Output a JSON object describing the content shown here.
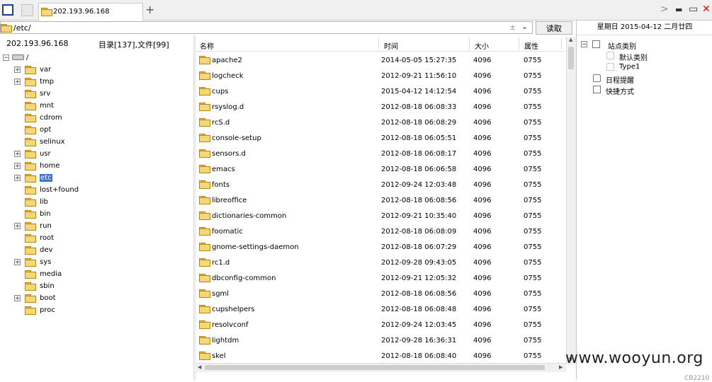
{
  "tab": {
    "title": "202.193.96.168",
    "add_label": "+"
  },
  "window": {
    "forward": ">",
    "minimize": "▬",
    "restore": "▭",
    "close": "✕"
  },
  "pathbar": {
    "path": "/etc/",
    "dropdown_plus": "±",
    "read_label": "读取"
  },
  "left_header": {
    "host": "202.193.96.168",
    "counts": "目录[137],文件[99]"
  },
  "tree": {
    "root": "/",
    "items": [
      {
        "label": "var",
        "expandable": true
      },
      {
        "label": "tmp",
        "expandable": true
      },
      {
        "label": "srv",
        "expandable": false
      },
      {
        "label": "mnt",
        "expandable": false
      },
      {
        "label": "cdrom",
        "expandable": false
      },
      {
        "label": "opt",
        "expandable": false
      },
      {
        "label": "selinux",
        "expandable": false
      },
      {
        "label": "usr",
        "expandable": true
      },
      {
        "label": "home",
        "expandable": true
      },
      {
        "label": "etc",
        "expandable": true,
        "selected": true
      },
      {
        "label": "lost+found",
        "expandable": false
      },
      {
        "label": "lib",
        "expandable": false
      },
      {
        "label": "bin",
        "expandable": false
      },
      {
        "label": "run",
        "expandable": true
      },
      {
        "label": "root",
        "expandable": false
      },
      {
        "label": "dev",
        "expandable": false
      },
      {
        "label": "sys",
        "expandable": true
      },
      {
        "label": "media",
        "expandable": false
      },
      {
        "label": "sbin",
        "expandable": false
      },
      {
        "label": "boot",
        "expandable": true
      },
      {
        "label": "proc",
        "expandable": false
      }
    ]
  },
  "list": {
    "columns": {
      "name": "名称",
      "time": "时间",
      "size": "大小",
      "attr": "属性"
    },
    "rows": [
      {
        "name": "apache2",
        "time": "2014-05-05 15:27:35",
        "size": "4096",
        "attr": "0755"
      },
      {
        "name": "logcheck",
        "time": "2012-09-21 11:56:10",
        "size": "4096",
        "attr": "0755"
      },
      {
        "name": "cups",
        "time": "2015-04-12 14:12:54",
        "size": "4096",
        "attr": "0755"
      },
      {
        "name": "rsyslog.d",
        "time": "2012-08-18 06:08:33",
        "size": "4096",
        "attr": "0755"
      },
      {
        "name": "rcS.d",
        "time": "2012-08-18 06:08:29",
        "size": "4096",
        "attr": "0755"
      },
      {
        "name": "console-setup",
        "time": "2012-08-18 06:05:51",
        "size": "4096",
        "attr": "0755"
      },
      {
        "name": "sensors.d",
        "time": "2012-08-18 06:08:17",
        "size": "4096",
        "attr": "0755"
      },
      {
        "name": "emacs",
        "time": "2012-08-18 06:06:58",
        "size": "4096",
        "attr": "0755"
      },
      {
        "name": "fonts",
        "time": "2012-09-24 12:03:48",
        "size": "4096",
        "attr": "0755"
      },
      {
        "name": "libreoffice",
        "time": "2012-08-18 06:08:56",
        "size": "4096",
        "attr": "0755"
      },
      {
        "name": "dictionaries-common",
        "time": "2012-09-21 10:35:40",
        "size": "4096",
        "attr": "0755"
      },
      {
        "name": "foomatic",
        "time": "2012-08-18 06:08:09",
        "size": "4096",
        "attr": "0755"
      },
      {
        "name": "gnome-settings-daemon",
        "time": "2012-08-18 06:07:29",
        "size": "4096",
        "attr": "0755"
      },
      {
        "name": "rc1.d",
        "time": "2012-09-28 09:43:05",
        "size": "4096",
        "attr": "0755"
      },
      {
        "name": "dbconfig-common",
        "time": "2012-09-21 12:05:32",
        "size": "4096",
        "attr": "0755"
      },
      {
        "name": "sgml",
        "time": "2012-08-18 06:08:56",
        "size": "4096",
        "attr": "0755"
      },
      {
        "name": "cupshelpers",
        "time": "2012-08-18 06:08:48",
        "size": "4096",
        "attr": "0755"
      },
      {
        "name": "resolvconf",
        "time": "2012-09-24 12:03:45",
        "size": "4096",
        "attr": "0755"
      },
      {
        "name": "lightdm",
        "time": "2012-09-28 16:36:31",
        "size": "4096",
        "attr": "0755"
      },
      {
        "name": "skel",
        "time": "2012-08-18 06:08:40",
        "size": "4096",
        "attr": "0755"
      }
    ]
  },
  "right_panel": {
    "date": "星期日 2015-04-12 二月廿四",
    "site_category": "站点类别",
    "default_category": "默认类别",
    "type1": "Type1",
    "schedule": "日程提醒",
    "shortcuts": "快捷方式"
  },
  "watermark": "www.wooyun.org",
  "corner_code": "CB2210",
  "colors": {
    "folder_fill": "#f7d57a",
    "folder_edge": "#b8860b",
    "selection": "#3875d7"
  }
}
